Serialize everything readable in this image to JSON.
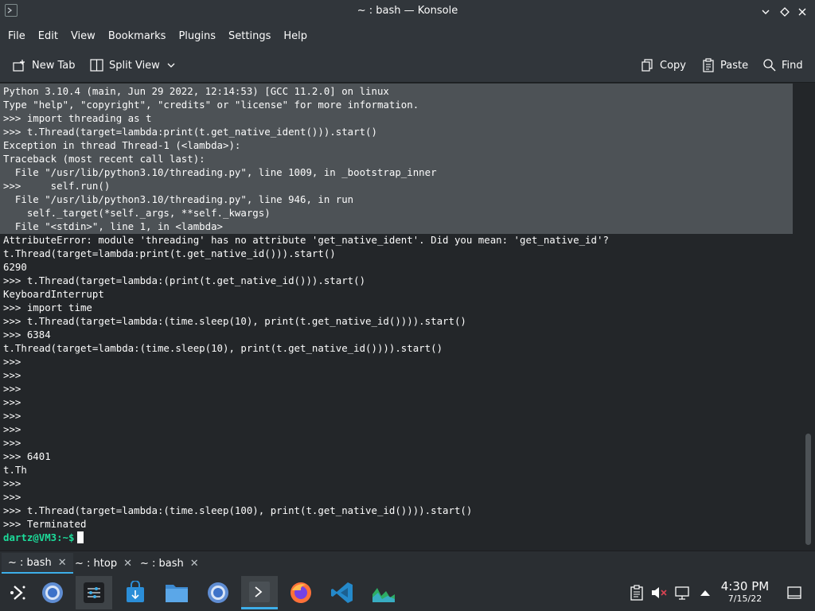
{
  "window": {
    "title": "~ : bash — Konsole"
  },
  "menubar": {
    "items": [
      "File",
      "Edit",
      "View",
      "Bookmarks",
      "Plugins",
      "Settings",
      "Help"
    ]
  },
  "toolbar": {
    "new_tab": "New Tab",
    "split_view": "Split View",
    "copy": "Copy",
    "paste": "Paste",
    "find": "Find"
  },
  "terminal": {
    "lines": [
      "Python 3.10.4 (main, Jun 29 2022, 12:14:53) [GCC 11.2.0] on linux",
      "Type \"help\", \"copyright\", \"credits\" or \"license\" for more information.",
      ">>> import threading as t",
      ">>> t.Thread(target=lambda:print(t.get_native_ident())).start()",
      "Exception in thread Thread-1 (<lambda>):",
      "Traceback (most recent call last):",
      "  File \"/usr/lib/python3.10/threading.py\", line 1009, in _bootstrap_inner",
      ">>>     self.run()",
      "  File \"/usr/lib/python3.10/threading.py\", line 946, in run",
      "    self._target(*self._args, **self._kwargs)",
      "  File \"<stdin>\", line 1, in <lambda>",
      "AttributeError: module 'threading' has no attribute 'get_native_ident'. Did you mean: 'get_native_id'?",
      "t.Thread(target=lambda:print(t.get_native_id())).start()",
      "6290",
      ">>> t.Thread(target=lambda:(print(t.get_native_id())).start()",
      "KeyboardInterrupt",
      ">>> import time",
      ">>> t.Thread(target=lambda:(time.sleep(10), print(t.get_native_id()))).start()",
      ">>> 6384",
      "t.Thread(target=lambda:(time.sleep(10), print(t.get_native_id()))).start()",
      ">>>",
      ">>>",
      ">>>",
      ">>>",
      ">>>",
      ">>>",
      ">>>",
      ">>> 6401",
      "t.Th",
      ">>>",
      ">>>",
      ">>> t.Thread(target=lambda:(time.sleep(100), print(t.get_native_id()))).start()",
      ">>> Terminated"
    ],
    "prompt_user": "dartz@VM3",
    "prompt_path": ":~$"
  },
  "tabs": [
    {
      "label": "~ : bash",
      "active": true
    },
    {
      "label": "~ : htop",
      "active": false
    },
    {
      "label": "~ : bash",
      "active": false
    }
  ],
  "taskbar": {
    "apps": [
      "application-launcher-icon",
      "chromium-icon",
      "system-settings-icon",
      "discover-icon",
      "dolphin-icon",
      "chromium-icon",
      "konsole-icon",
      "firefox-icon",
      "vscode-icon",
      "system-monitor-icon"
    ],
    "active_app": "konsole-icon",
    "time": "4:30 PM",
    "date": "7/15/22"
  },
  "colors": {
    "accent": "#3daee9",
    "prompt_user": "#1cdc9a",
    "background": "#232629",
    "selection": "#4d5256"
  }
}
